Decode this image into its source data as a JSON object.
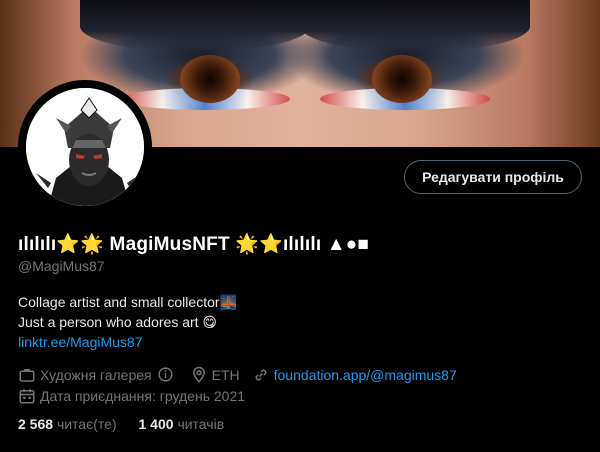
{
  "profile": {
    "display_name": "ılılılı⭐🌟 MagiMusNFT 🌟⭐ılılılı ▲●■",
    "handle": "@MagiMus87",
    "edit_button_label": "Редагувати профіль",
    "bio_line1": "Collage artist and small collector🌉",
    "bio_line2": "Just a person who adores art 😋",
    "bio_link": "linktr.ee/MagiMus87",
    "category": "Художня галерея",
    "location": "ETH",
    "website": "foundation.app/@magimus87",
    "joined": "Дата приєднання: грудень 2021",
    "following_count": "2 568",
    "following_label": "читає(те)",
    "followers_count": "1 400",
    "followers_label": "читачів"
  },
  "icons": {
    "category": "briefcase-icon",
    "info": "info-icon",
    "location": "location-pin-icon",
    "website": "link-icon",
    "joined": "calendar-icon"
  },
  "colors": {
    "background": "#000000",
    "link": "#1d9bf0",
    "secondary_text": "#71767b",
    "primary_text": "#e7e9ea"
  }
}
